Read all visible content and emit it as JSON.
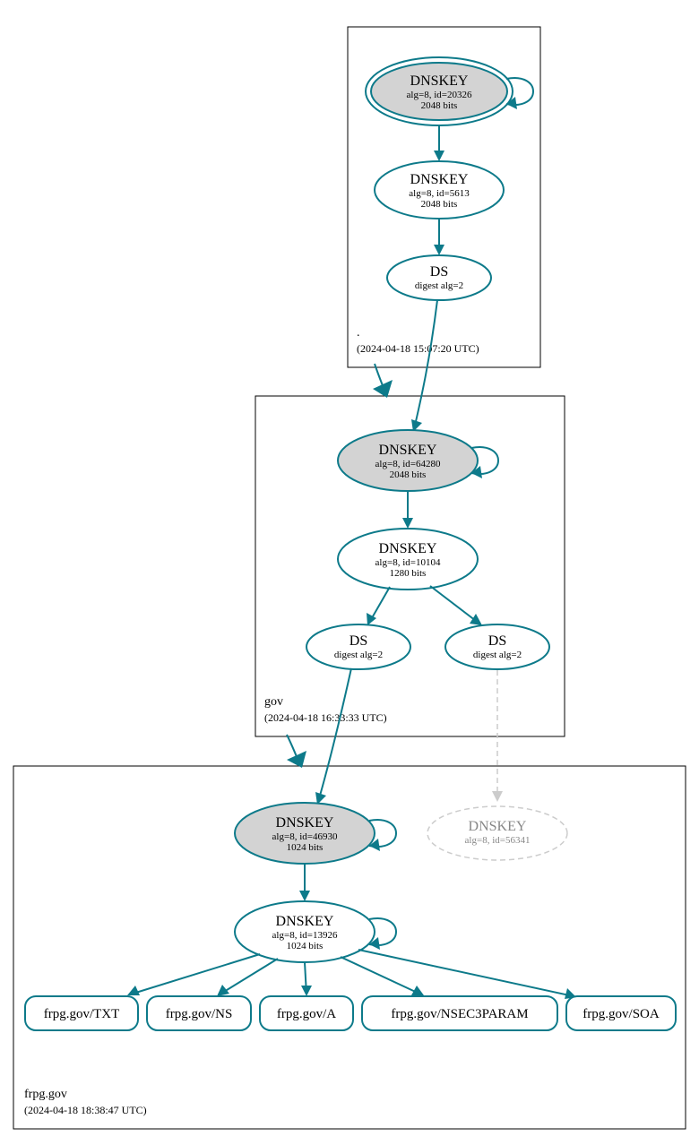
{
  "zones": {
    "root": {
      "title": ".",
      "timestamp": "(2024-04-18 15:07:20 UTC)"
    },
    "gov": {
      "title": "gov",
      "timestamp": "(2024-04-18 16:33:33 UTC)"
    },
    "frpg": {
      "title": "frpg.gov",
      "timestamp": "(2024-04-18 18:38:47 UTC)"
    }
  },
  "nodes": {
    "root_ksk": {
      "title": "DNSKEY",
      "sub1": "alg=8, id=20326",
      "sub2": "2048 bits"
    },
    "root_zsk": {
      "title": "DNSKEY",
      "sub1": "alg=8, id=5613",
      "sub2": "2048 bits"
    },
    "root_ds": {
      "title": "DS",
      "sub1": "digest alg=2"
    },
    "gov_ksk": {
      "title": "DNSKEY",
      "sub1": "alg=8, id=64280",
      "sub2": "2048 bits"
    },
    "gov_zsk": {
      "title": "DNSKEY",
      "sub1": "alg=8, id=10104",
      "sub2": "1280 bits"
    },
    "gov_ds1": {
      "title": "DS",
      "sub1": "digest alg=2"
    },
    "gov_ds2": {
      "title": "DS",
      "sub1": "digest alg=2"
    },
    "frpg_ksk": {
      "title": "DNSKEY",
      "sub1": "alg=8, id=46930",
      "sub2": "1024 bits"
    },
    "frpg_zsk": {
      "title": "DNSKEY",
      "sub1": "alg=8, id=13926",
      "sub2": "1024 bits"
    },
    "frpg_missing": {
      "title": "DNSKEY",
      "sub1": "alg=8, id=56341"
    },
    "rr_txt": "frpg.gov/TXT",
    "rr_ns": "frpg.gov/NS",
    "rr_a": "frpg.gov/A",
    "rr_nsec3param": "frpg.gov/NSEC3PARAM",
    "rr_soa": "frpg.gov/SOA"
  }
}
